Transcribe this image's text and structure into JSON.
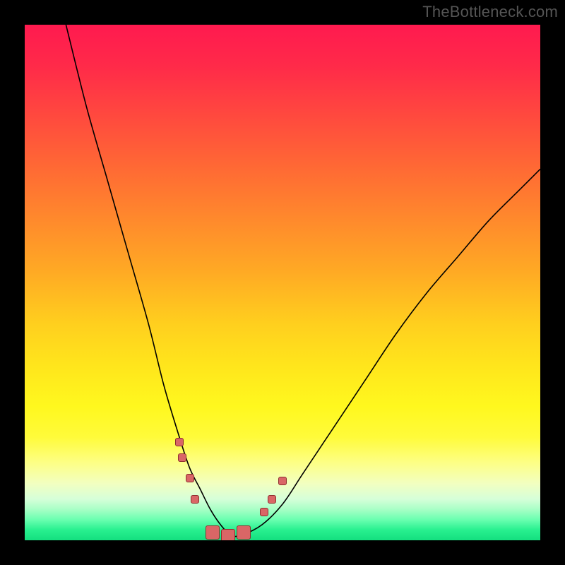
{
  "watermark_text": "TheBottleneck.com",
  "colors": {
    "page_bg": "#000000",
    "watermark": "#555555",
    "curve_stroke": "#000000",
    "marker_fill": "#d96666",
    "marker_border": "#8e2e2e",
    "gradient_stops": [
      "#ff1a4f",
      "#ff2a49",
      "#ff4a3e",
      "#ff6a34",
      "#ff8a2c",
      "#ffaa24",
      "#ffcf1e",
      "#ffe51c",
      "#fff81e",
      "#fffb3a",
      "#fdff86",
      "#f2ffc0",
      "#d6ffd9",
      "#a8ffc6",
      "#6affb0",
      "#28f08f",
      "#14df7f"
    ]
  },
  "chart_data": {
    "type": "line",
    "title": "",
    "xlabel": "",
    "ylabel": "",
    "xlim": [
      0,
      100
    ],
    "ylim": [
      0,
      100
    ],
    "grid": false,
    "legend": "none",
    "annotations": [],
    "series": [
      {
        "name": "bottleneck-curve",
        "x": [
          8,
          12,
          16,
          20,
          24,
          27,
          30,
          32,
          34,
          36,
          38,
          40,
          42,
          46,
          50,
          54,
          60,
          66,
          72,
          78,
          84,
          90,
          96,
          100
        ],
        "y": [
          100,
          84,
          70,
          56,
          42,
          30,
          20,
          14,
          10,
          6,
          3,
          1,
          1,
          3,
          7,
          13,
          22,
          31,
          40,
          48,
          55,
          62,
          68,
          72
        ]
      }
    ],
    "markers": [
      {
        "cluster": "left-shoulder",
        "x": 30.0,
        "y": 19.0,
        "size": "small"
      },
      {
        "cluster": "left-shoulder",
        "x": 30.6,
        "y": 16.0,
        "size": "small"
      },
      {
        "cluster": "left-shoulder",
        "x": 32.0,
        "y": 12.0,
        "size": "small"
      },
      {
        "cluster": "left-shoulder",
        "x": 33.0,
        "y": 8.0,
        "size": "small"
      },
      {
        "cluster": "trough",
        "x": 36.5,
        "y": 1.5,
        "size": "large"
      },
      {
        "cluster": "trough",
        "x": 39.5,
        "y": 0.8,
        "size": "large"
      },
      {
        "cluster": "trough",
        "x": 42.5,
        "y": 1.5,
        "size": "large"
      },
      {
        "cluster": "right-shoulder",
        "x": 46.5,
        "y": 5.5,
        "size": "small"
      },
      {
        "cluster": "right-shoulder",
        "x": 48.0,
        "y": 8.0,
        "size": "small"
      },
      {
        "cluster": "right-shoulder",
        "x": 50.0,
        "y": 11.5,
        "size": "small"
      }
    ],
    "marker_sizes": {
      "small": 12,
      "large": 20
    }
  }
}
